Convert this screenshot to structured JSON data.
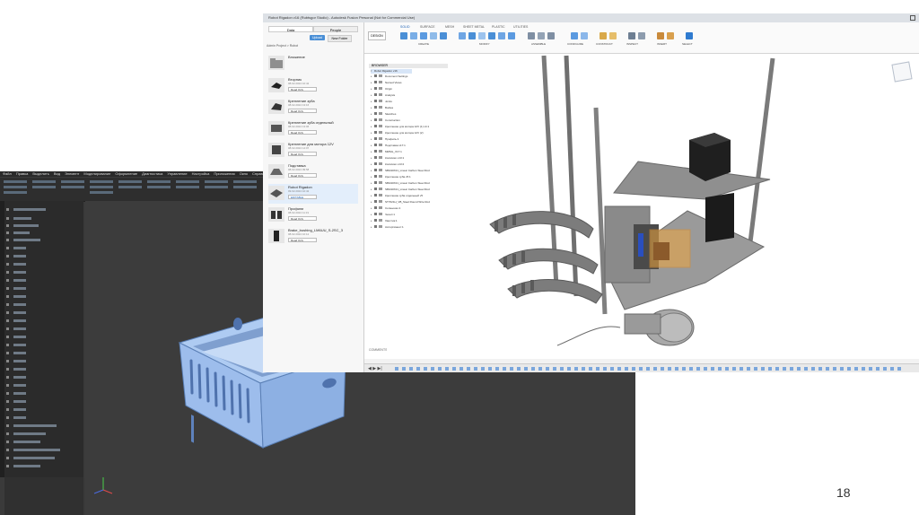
{
  "cad_window": {
    "menu": [
      "Файл",
      "Правка",
      "Выделить",
      "Вид",
      "Элемент",
      "Моделирование",
      "Оформление",
      "Диагностика",
      "Управление",
      "Настройка",
      "Приложения",
      "Окно",
      "Справка"
    ],
    "colors": {
      "background": "#3a3a3a",
      "model": "#9cc0f0",
      "model_shade": "#6f93c8"
    }
  },
  "fusion_window": {
    "title": "Robot Rigadon v16 (Rubtsgor Studio) - Autodesk Fusion Personal (Not for Commercial Use)",
    "data_panel": {
      "tabs": [
        "Data",
        "People"
      ],
      "upload_label": "Upload",
      "new_folder_label": "New Folder",
      "breadcrumb": "Admin Project > Robot",
      "items": [
        {
          "name": "Вложение",
          "meta": "",
          "button": ""
        },
        {
          "name": "Вторник",
          "meta": "08.02.2024 10:42",
          "button": "Read Only"
        },
        {
          "name": "Крепление зуба",
          "meta": "08.02.2024 13:16",
          "button": "Read Only"
        },
        {
          "name": "Крепление зуба отдельный",
          "meta": "08.02.2024 13:06",
          "button": "Read Only"
        },
        {
          "name": "Крепление для мотора 12V",
          "meta": "08.02.2024 14:07",
          "button": "Read Only"
        },
        {
          "name": "Подставка",
          "meta": "08.02.2024 09:58",
          "button": "Read Only"
        },
        {
          "name": "Robot Rigadon",
          "meta": "09.02.2024 10:42",
          "button": "EDITABLE"
        },
        {
          "name": "Профили",
          "meta": "08.02.2024 11:31",
          "button": "Read Only"
        },
        {
          "name": "Brake_bushing_LM6UU_S-2SC_3",
          "meta": "08.02.2024 10:12",
          "button": "Read Only"
        }
      ]
    },
    "toolbar": {
      "workspace": "DESIGN",
      "tabs": [
        "SOLID",
        "SURFACE",
        "MESH",
        "SHEET METAL",
        "PLASTIC",
        "UTILITIES"
      ],
      "groups": [
        "CREATE",
        "MODIFY",
        "ASSEMBLE",
        "CONFIGURE",
        "CONSTRUCT",
        "INSPECT",
        "INSERT",
        "SELECT"
      ]
    },
    "browser": {
      "header": "BROWSER",
      "root": "Robot Rigadon v16",
      "items": [
        "Document Settings",
        "Named Views",
        "Origin",
        "Analysis",
        "Joints",
        "Bodies",
        "Sketches",
        "Construction",
        "Крепление для мотора 12V (1) v4:1",
        "Крепление для мотора 12V (2)",
        "Профиль:1",
        "Подставка v17:1",
        "MMSG_V17:1",
        "Колёсико v13:1",
        "Колёсико v13:2",
        "SBG90X21_Linear Carbon Steel Rod",
        "Крепление зуба v5:1",
        "SBG90X21_Linear Carbon Steel Rod",
        "SBG90X21_Linear Carbon Steel Rod",
        "Крепление зуба отдельный v5",
        "ST7021H_VB_Steel Round Wire Rod",
        "Солнышко:1",
        "Чехол:1",
        "Хвостик:1",
        "Ассортимент:1"
      ]
    },
    "comments_label": "COMMENTS",
    "colors": {
      "accent": "#4a8fd6",
      "model": "#9a9a9a",
      "model_dark": "#1e1e1e",
      "highlight": "#f0a63c"
    }
  },
  "page_number": "18"
}
